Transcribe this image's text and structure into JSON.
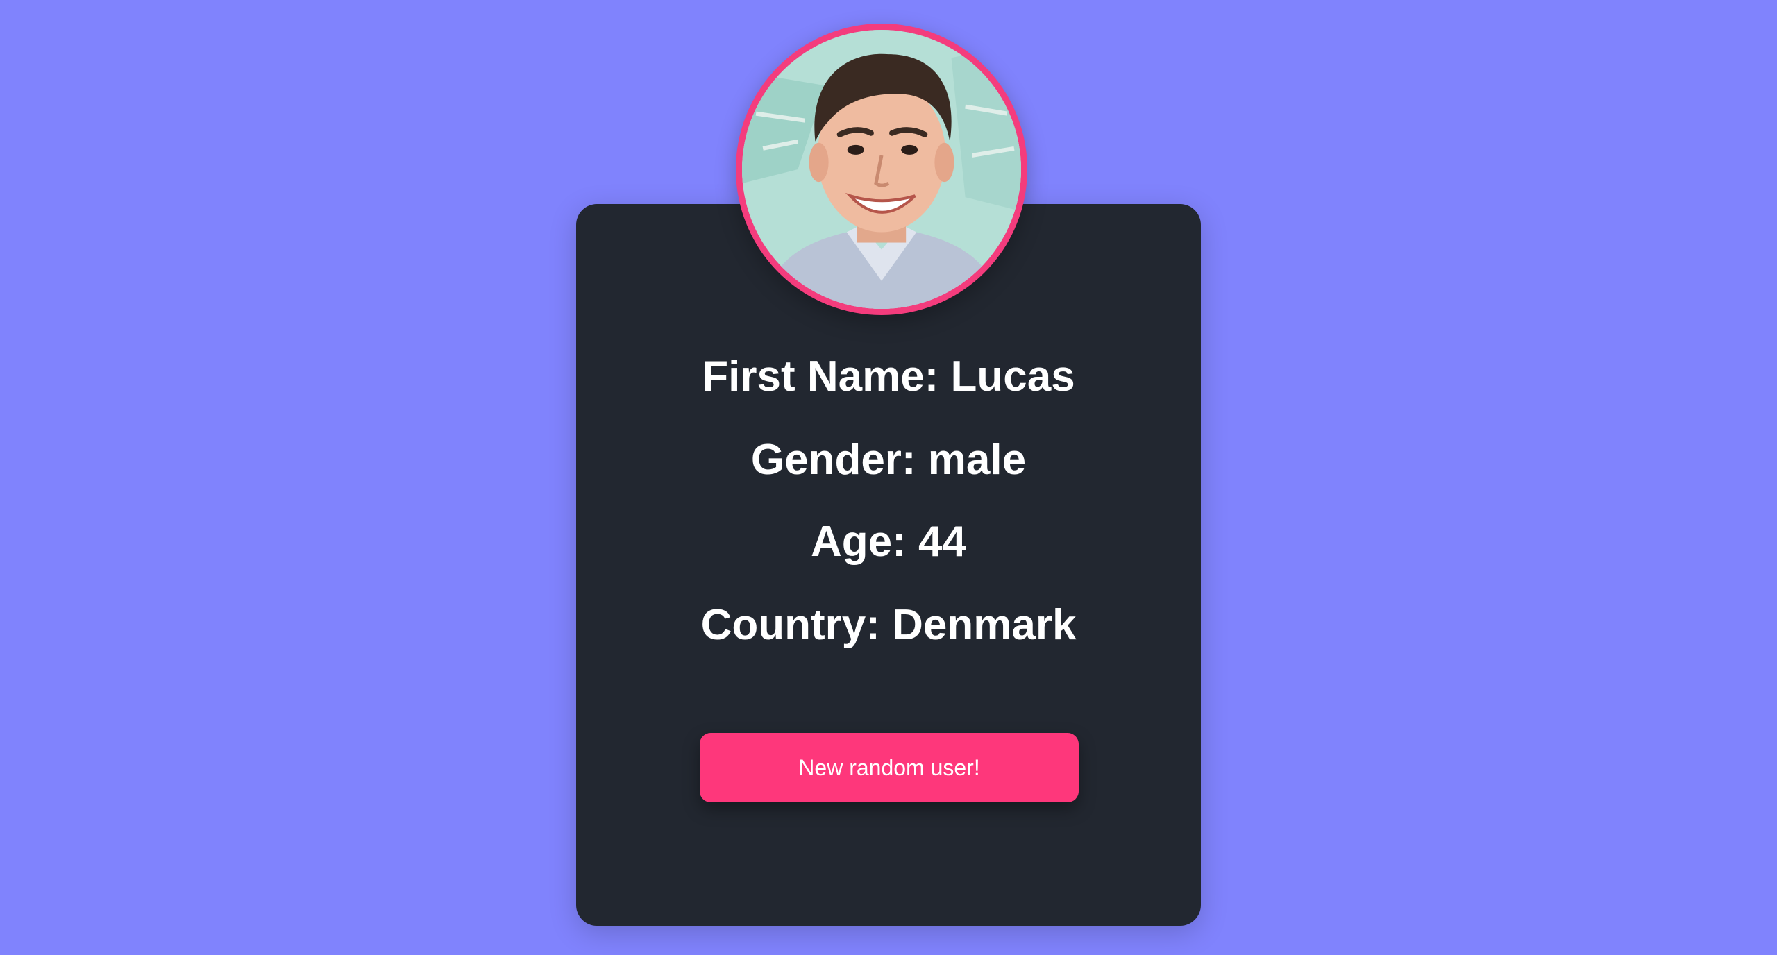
{
  "profile": {
    "first_name_line": "First Name: Lucas",
    "gender_line": "Gender: male",
    "age_line": "Age: 44",
    "country_line": "Country: Denmark"
  },
  "actions": {
    "new_user_label": "New random user!"
  },
  "colors": {
    "page_background": "#8083fd",
    "card_background": "#222730",
    "accent_pink": "#fe377b",
    "avatar_ring": "#f43c7d",
    "text": "#ffffff"
  },
  "icons": {
    "avatar": "user-photo"
  }
}
